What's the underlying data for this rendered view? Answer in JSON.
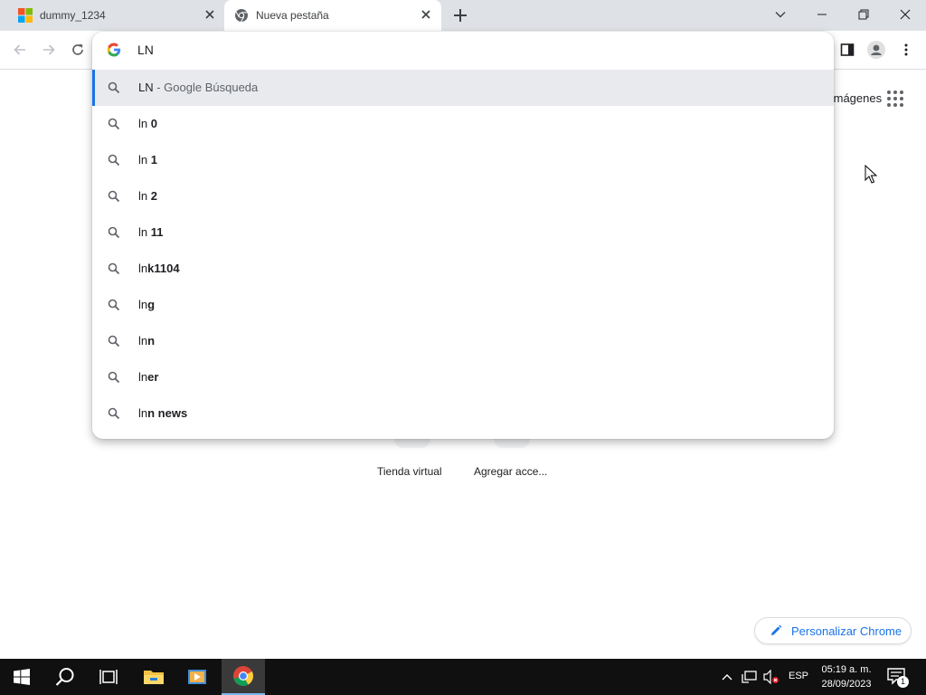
{
  "tabs": [
    {
      "title": "dummy_1234",
      "active": false
    },
    {
      "title": "Nueva pestaña",
      "active": true
    }
  ],
  "omnibox": {
    "input_value": "LN",
    "suggestions": [
      {
        "prefix": "LN",
        "bold": "",
        "suffix": " - Google Búsqueda",
        "selected": true
      },
      {
        "prefix": "ln ",
        "bold": "0",
        "suffix": ""
      },
      {
        "prefix": "ln ",
        "bold": "1",
        "suffix": ""
      },
      {
        "prefix": "ln ",
        "bold": "2",
        "suffix": ""
      },
      {
        "prefix": "ln ",
        "bold": "11",
        "suffix": ""
      },
      {
        "prefix": "ln",
        "bold": "k1104",
        "suffix": ""
      },
      {
        "prefix": "ln",
        "bold": "g",
        "suffix": ""
      },
      {
        "prefix": "ln",
        "bold": "n",
        "suffix": ""
      },
      {
        "prefix": "ln",
        "bold": "er",
        "suffix": ""
      },
      {
        "prefix": "ln",
        "bold": "n news",
        "suffix": ""
      }
    ]
  },
  "page": {
    "imagenes_link": "Imágenes",
    "shortcuts": [
      "Tienda virtual",
      "Agregar acce..."
    ],
    "customize_label": "Personalizar Chrome"
  },
  "taskbar": {
    "language": "ESP",
    "time": "05:19 a. m.",
    "date": "28/09/2023",
    "notification_count": "1"
  },
  "colors": {
    "accent": "#1a73e8",
    "tabstrip": "#dee1e6",
    "taskbar": "#101010"
  }
}
